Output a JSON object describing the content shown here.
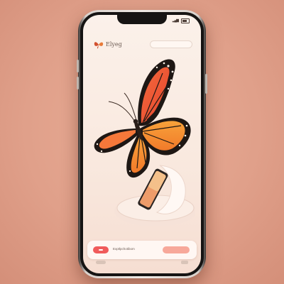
{
  "status_bar": {
    "time": "",
    "signal_icon": "signal-icon",
    "battery_icon": "battery-icon"
  },
  "header": {
    "logo_icon": "butterfly-logo-icon",
    "title": "Elyeg",
    "search_placeholder": ""
  },
  "hero": {
    "image": "monarch-butterfly",
    "product_image": "phone-on-stand"
  },
  "bottom_bar": {
    "title": "Exptlpchotibom",
    "subtitle": ""
  },
  "colors": {
    "background": "#e0a08a",
    "accent": "#f05b5b",
    "accent_light": "#f7a89a",
    "screen": "#fbf1ea"
  }
}
